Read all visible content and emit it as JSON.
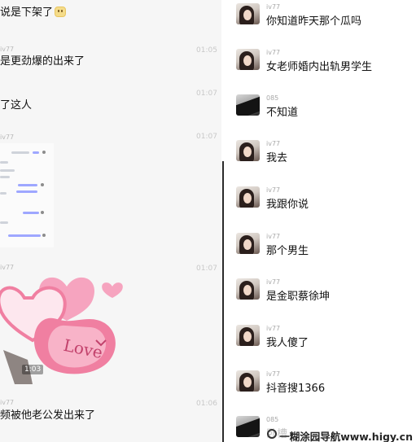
{
  "left_chat": {
    "messages": [
      {
        "text": "说是下架了",
        "has_emoji": true
      },
      {
        "name": "iv77",
        "text": "是更劲爆的出来了",
        "time": "01:05"
      },
      {
        "text": "了这人",
        "time": "01:07"
      },
      {
        "name": "iv77",
        "time": "01:07"
      },
      {
        "name": "iv77",
        "time": "01:07"
      },
      {
        "name": "iv77",
        "text": "频被他老公发出来了",
        "time": "01:06"
      }
    ],
    "video_duration": "1:03",
    "sticker_text": "Love"
  },
  "right_chat": {
    "messages": [
      {
        "name": "iv77",
        "text": "你知道昨天那个瓜吗",
        "avatar": "girl"
      },
      {
        "name": "iv77",
        "text": "女老师婚内出轨男学生",
        "avatar": "girl"
      },
      {
        "name": "085",
        "text": "不知道",
        "avatar": "dark"
      },
      {
        "name": "iv77",
        "text": "我去",
        "avatar": "girl"
      },
      {
        "name": "iv77",
        "text": "我跟你说",
        "avatar": "girl"
      },
      {
        "name": "iv77",
        "text": "那个男生",
        "avatar": "girl"
      },
      {
        "name": "iv77",
        "text": "是金职蔡徐坤",
        "avatar": "girl"
      },
      {
        "name": "iv77",
        "text": "我人傻了",
        "avatar": "girl"
      },
      {
        "name": "iv77",
        "text": "抖音搜1366",
        "avatar": "girl"
      },
      {
        "name": "085",
        "text": "卧槽",
        "avatar": "dark"
      }
    ]
  },
  "watermark": {
    "text": "一糊涂园导航www.higy.cn"
  },
  "colors": {
    "panel_bg": "#f6f6f6",
    "name_gray": "#a8a8a8",
    "bubble_purple": "#9ea7ff",
    "sticker_pink": "#f07fa1"
  }
}
